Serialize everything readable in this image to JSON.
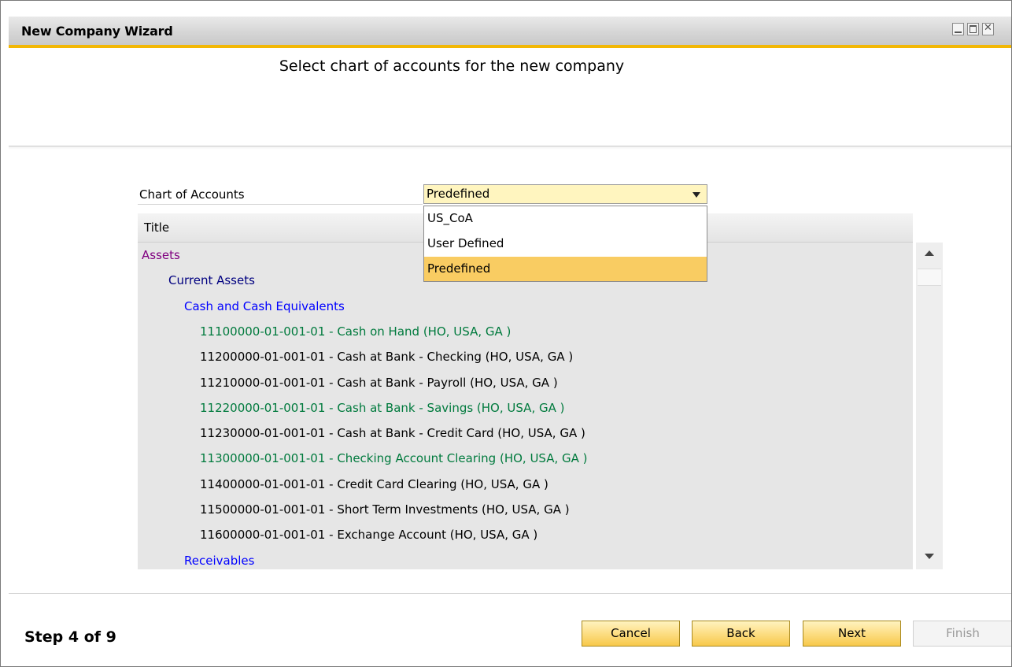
{
  "window": {
    "title": "New Company Wizard",
    "accent_color": "#f2b705"
  },
  "heading": "Select chart of accounts for the new company",
  "chart_of_accounts": {
    "label": "Chart of Accounts",
    "selected_value": "Predefined",
    "options": [
      {
        "label": "US_CoA",
        "selected": false
      },
      {
        "label": "User Defined",
        "selected": false
      },
      {
        "label": "Predefined",
        "selected": true
      }
    ]
  },
  "grid": {
    "column_header": "Title",
    "rows": [
      {
        "text": "Assets",
        "level": 0,
        "color": "#800080"
      },
      {
        "text": "Current Assets",
        "level": 1,
        "color": "#000080"
      },
      {
        "text": "Cash and Cash Equivalents",
        "level": 2,
        "color": "#0000ff"
      },
      {
        "text": "11100000-01-001-01 - Cash on Hand (HO, USA, GA )",
        "level": 3,
        "color": "#007a3d"
      },
      {
        "text": "11200000-01-001-01 - Cash at Bank - Checking (HO, USA, GA )",
        "level": 3,
        "color": "#000000"
      },
      {
        "text": "11210000-01-001-01 - Cash at Bank - Payroll (HO, USA, GA )",
        "level": 3,
        "color": "#000000"
      },
      {
        "text": "11220000-01-001-01 - Cash at Bank - Savings (HO, USA, GA )",
        "level": 3,
        "color": "#007a3d"
      },
      {
        "text": "11230000-01-001-01 - Cash at Bank - Credit Card (HO, USA, GA )",
        "level": 3,
        "color": "#000000"
      },
      {
        "text": "11300000-01-001-01 - Checking Account Clearing (HO, USA, GA )",
        "level": 3,
        "color": "#007a3d"
      },
      {
        "text": "11400000-01-001-01 - Credit Card Clearing (HO, USA, GA )",
        "level": 3,
        "color": "#000000"
      },
      {
        "text": "11500000-01-001-01 - Short Term Investments (HO, USA, GA )",
        "level": 3,
        "color": "#000000"
      },
      {
        "text": "11600000-01-001-01 - Exchange Account (HO, USA, GA )",
        "level": 3,
        "color": "#000000"
      },
      {
        "text": "Receivables",
        "level": 2,
        "color": "#0000ff"
      }
    ]
  },
  "footer": {
    "step_text": "Step 4 of 9",
    "buttons": {
      "cancel": "Cancel",
      "back": "Back",
      "next": "Next",
      "finish": "Finish"
    }
  },
  "icons": {
    "minimize": "minimize-icon",
    "maximize": "maximize-icon",
    "close": "close-icon",
    "dropdown": "chevron-down-icon",
    "scroll_up": "scroll-up-arrow-icon",
    "scroll_down": "scroll-down-arrow-icon"
  }
}
